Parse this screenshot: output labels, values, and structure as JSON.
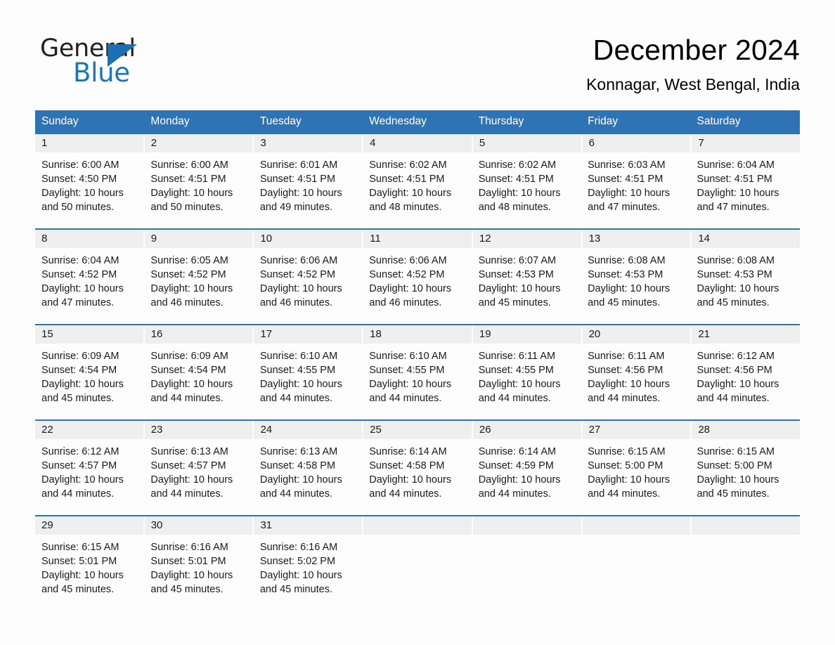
{
  "brand": {
    "name_part1": "General",
    "name_part2": "Blue",
    "triangle_color": "#1b6fb5",
    "blue_color": "#1b75bc"
  },
  "header": {
    "title": "December 2024",
    "subtitle": "Konnagar, West Bengal, India"
  },
  "theme": {
    "header_blue": "#2e74b5",
    "date_band_gray": "#efefef",
    "page_background": "#fdfdfd",
    "text_color": "#1a1a1a"
  },
  "weekdays": [
    "Sunday",
    "Monday",
    "Tuesday",
    "Wednesday",
    "Thursday",
    "Friday",
    "Saturday"
  ],
  "weeks": [
    {
      "days": [
        {
          "date": "1",
          "sunrise": "Sunrise: 6:00 AM",
          "sunset": "Sunset: 4:50 PM",
          "daylight": "Daylight: 10 hours and 50 minutes."
        },
        {
          "date": "2",
          "sunrise": "Sunrise: 6:00 AM",
          "sunset": "Sunset: 4:51 PM",
          "daylight": "Daylight: 10 hours and 50 minutes."
        },
        {
          "date": "3",
          "sunrise": "Sunrise: 6:01 AM",
          "sunset": "Sunset: 4:51 PM",
          "daylight": "Daylight: 10 hours and 49 minutes."
        },
        {
          "date": "4",
          "sunrise": "Sunrise: 6:02 AM",
          "sunset": "Sunset: 4:51 PM",
          "daylight": "Daylight: 10 hours and 48 minutes."
        },
        {
          "date": "5",
          "sunrise": "Sunrise: 6:02 AM",
          "sunset": "Sunset: 4:51 PM",
          "daylight": "Daylight: 10 hours and 48 minutes."
        },
        {
          "date": "6",
          "sunrise": "Sunrise: 6:03 AM",
          "sunset": "Sunset: 4:51 PM",
          "daylight": "Daylight: 10 hours and 47 minutes."
        },
        {
          "date": "7",
          "sunrise": "Sunrise: 6:04 AM",
          "sunset": "Sunset: 4:51 PM",
          "daylight": "Daylight: 10 hours and 47 minutes."
        }
      ]
    },
    {
      "days": [
        {
          "date": "8",
          "sunrise": "Sunrise: 6:04 AM",
          "sunset": "Sunset: 4:52 PM",
          "daylight": "Daylight: 10 hours and 47 minutes."
        },
        {
          "date": "9",
          "sunrise": "Sunrise: 6:05 AM",
          "sunset": "Sunset: 4:52 PM",
          "daylight": "Daylight: 10 hours and 46 minutes."
        },
        {
          "date": "10",
          "sunrise": "Sunrise: 6:06 AM",
          "sunset": "Sunset: 4:52 PM",
          "daylight": "Daylight: 10 hours and 46 minutes."
        },
        {
          "date": "11",
          "sunrise": "Sunrise: 6:06 AM",
          "sunset": "Sunset: 4:52 PM",
          "daylight": "Daylight: 10 hours and 46 minutes."
        },
        {
          "date": "12",
          "sunrise": "Sunrise: 6:07 AM",
          "sunset": "Sunset: 4:53 PM",
          "daylight": "Daylight: 10 hours and 45 minutes."
        },
        {
          "date": "13",
          "sunrise": "Sunrise: 6:08 AM",
          "sunset": "Sunset: 4:53 PM",
          "daylight": "Daylight: 10 hours and 45 minutes."
        },
        {
          "date": "14",
          "sunrise": "Sunrise: 6:08 AM",
          "sunset": "Sunset: 4:53 PM",
          "daylight": "Daylight: 10 hours and 45 minutes."
        }
      ]
    },
    {
      "days": [
        {
          "date": "15",
          "sunrise": "Sunrise: 6:09 AM",
          "sunset": "Sunset: 4:54 PM",
          "daylight": "Daylight: 10 hours and 45 minutes."
        },
        {
          "date": "16",
          "sunrise": "Sunrise: 6:09 AM",
          "sunset": "Sunset: 4:54 PM",
          "daylight": "Daylight: 10 hours and 44 minutes."
        },
        {
          "date": "17",
          "sunrise": "Sunrise: 6:10 AM",
          "sunset": "Sunset: 4:55 PM",
          "daylight": "Daylight: 10 hours and 44 minutes."
        },
        {
          "date": "18",
          "sunrise": "Sunrise: 6:10 AM",
          "sunset": "Sunset: 4:55 PM",
          "daylight": "Daylight: 10 hours and 44 minutes."
        },
        {
          "date": "19",
          "sunrise": "Sunrise: 6:11 AM",
          "sunset": "Sunset: 4:55 PM",
          "daylight": "Daylight: 10 hours and 44 minutes."
        },
        {
          "date": "20",
          "sunrise": "Sunrise: 6:11 AM",
          "sunset": "Sunset: 4:56 PM",
          "daylight": "Daylight: 10 hours and 44 minutes."
        },
        {
          "date": "21",
          "sunrise": "Sunrise: 6:12 AM",
          "sunset": "Sunset: 4:56 PM",
          "daylight": "Daylight: 10 hours and 44 minutes."
        }
      ]
    },
    {
      "days": [
        {
          "date": "22",
          "sunrise": "Sunrise: 6:12 AM",
          "sunset": "Sunset: 4:57 PM",
          "daylight": "Daylight: 10 hours and 44 minutes."
        },
        {
          "date": "23",
          "sunrise": "Sunrise: 6:13 AM",
          "sunset": "Sunset: 4:57 PM",
          "daylight": "Daylight: 10 hours and 44 minutes."
        },
        {
          "date": "24",
          "sunrise": "Sunrise: 6:13 AM",
          "sunset": "Sunset: 4:58 PM",
          "daylight": "Daylight: 10 hours and 44 minutes."
        },
        {
          "date": "25",
          "sunrise": "Sunrise: 6:14 AM",
          "sunset": "Sunset: 4:58 PM",
          "daylight": "Daylight: 10 hours and 44 minutes."
        },
        {
          "date": "26",
          "sunrise": "Sunrise: 6:14 AM",
          "sunset": "Sunset: 4:59 PM",
          "daylight": "Daylight: 10 hours and 44 minutes."
        },
        {
          "date": "27",
          "sunrise": "Sunrise: 6:15 AM",
          "sunset": "Sunset: 5:00 PM",
          "daylight": "Daylight: 10 hours and 44 minutes."
        },
        {
          "date": "28",
          "sunrise": "Sunrise: 6:15 AM",
          "sunset": "Sunset: 5:00 PM",
          "daylight": "Daylight: 10 hours and 45 minutes."
        }
      ]
    },
    {
      "days": [
        {
          "date": "29",
          "sunrise": "Sunrise: 6:15 AM",
          "sunset": "Sunset: 5:01 PM",
          "daylight": "Daylight: 10 hours and 45 minutes."
        },
        {
          "date": "30",
          "sunrise": "Sunrise: 6:16 AM",
          "sunset": "Sunset: 5:01 PM",
          "daylight": "Daylight: 10 hours and 45 minutes."
        },
        {
          "date": "31",
          "sunrise": "Sunrise: 6:16 AM",
          "sunset": "Sunset: 5:02 PM",
          "daylight": "Daylight: 10 hours and 45 minutes."
        },
        {
          "date": "",
          "sunrise": "",
          "sunset": "",
          "daylight": ""
        },
        {
          "date": "",
          "sunrise": "",
          "sunset": "",
          "daylight": ""
        },
        {
          "date": "",
          "sunrise": "",
          "sunset": "",
          "daylight": ""
        },
        {
          "date": "",
          "sunrise": "",
          "sunset": "",
          "daylight": ""
        }
      ]
    }
  ]
}
